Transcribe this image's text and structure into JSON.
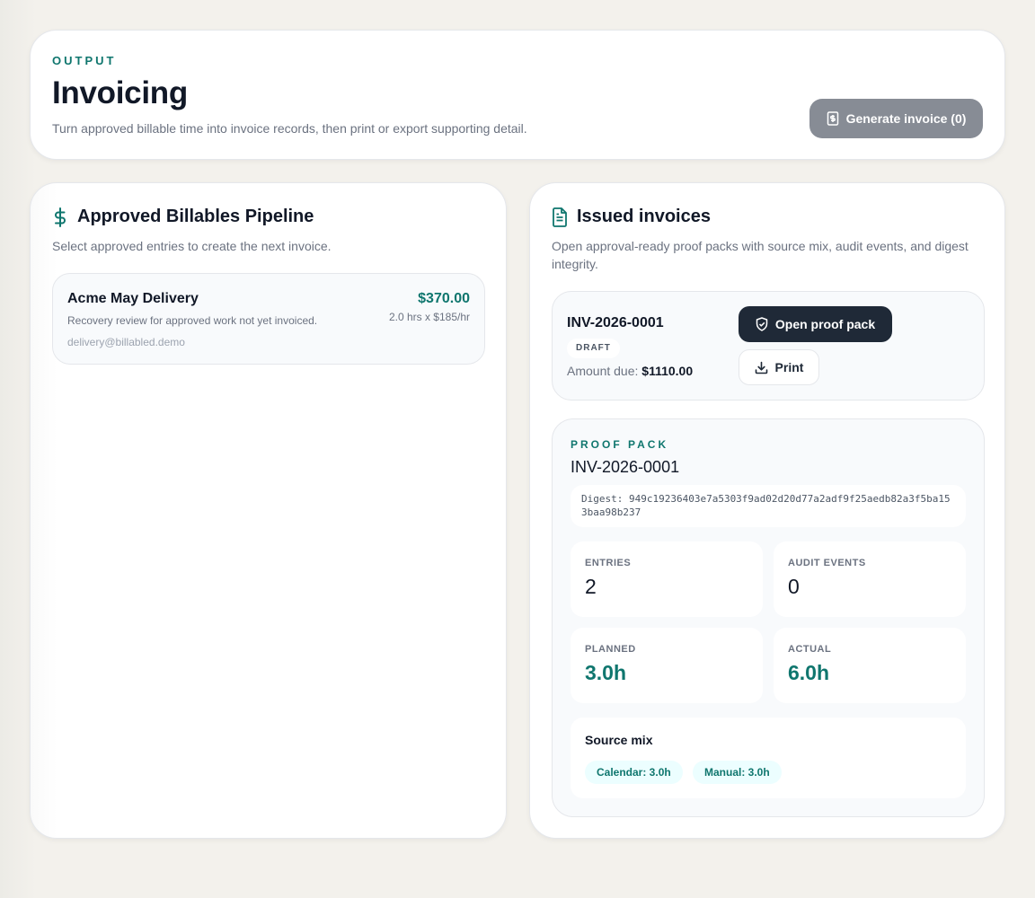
{
  "header": {
    "eyebrow": "OUTPUT",
    "title": "Invoicing",
    "subtitle": "Turn approved billable time into invoice records, then print or export supporting detail.",
    "generate_button": "Generate invoice (0)",
    "generate_icon": "invoice-icon"
  },
  "pipeline": {
    "title": "Approved Billables Pipeline",
    "title_icon": "dollar-icon",
    "subtitle": "Select approved entries to create the next invoice.",
    "items": [
      {
        "client": "Acme May Delivery",
        "description": "Recovery review for approved work not yet invoiced.",
        "email": "delivery@billabled.demo",
        "amount": "$370.00",
        "rate": "2.0 hrs x $185/hr"
      }
    ]
  },
  "issued": {
    "title": "Issued invoices",
    "title_icon": "document-icon",
    "subtitle": "Open approval-ready proof packs with source mix, audit events, and digest integrity.",
    "invoices": [
      {
        "number": "INV-2026-0001",
        "status": "DRAFT",
        "amount_label": "Amount due:",
        "amount": "$1110.00",
        "open_button": "Open proof pack",
        "print_button": "Print"
      }
    ]
  },
  "proof_pack": {
    "eyebrow": "PROOF PACK",
    "number": "INV-2026-0001",
    "digest": "Digest: 949c19236403e7a5303f9ad02d20d77a2adf9f25aedb82a3f5ba153baa98b237",
    "stats": {
      "entries": {
        "label": "ENTRIES",
        "value": "2"
      },
      "audit": {
        "label": "AUDIT EVENTS",
        "value": "0"
      },
      "planned": {
        "label": "PLANNED",
        "value": "3.0h"
      },
      "actual": {
        "label": "ACTUAL",
        "value": "6.0h"
      }
    },
    "source_mix": {
      "title": "Source mix",
      "chips": [
        "Calendar: 3.0h",
        "Manual: 3.0h"
      ]
    }
  },
  "colors": {
    "accent": "#0f766e",
    "dark_button": "#1f2937",
    "disabled_button": "#878c95"
  }
}
